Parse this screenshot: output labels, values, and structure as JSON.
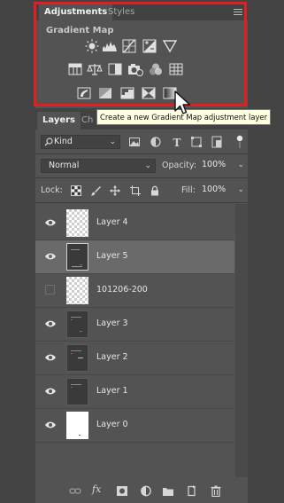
{
  "adjustments": {
    "tabs": [
      {
        "label": "Adjustments",
        "active": true
      },
      {
        "label": "Styles",
        "active": false
      }
    ],
    "subtitle": "Gradient Map",
    "highlight_color": "#e41e1e",
    "row1_icons": [
      "brightness-contrast-icon",
      "levels-icon",
      "curves-icon",
      "exposure-icon",
      "vibrance-icon"
    ],
    "row2_icons": [
      "hue-saturation-icon",
      "color-balance-icon",
      "black-white-icon",
      "photo-filter-icon",
      "channel-mixer-icon",
      "color-lookup-icon"
    ],
    "row3_icons": [
      "invert-icon",
      "posterize-icon",
      "threshold-icon",
      "selective-color-icon",
      "gradient-map-icon"
    ]
  },
  "tooltip": {
    "text": "Create a new Gradient Map adjustment layer"
  },
  "layers_panel": {
    "tabs": [
      {
        "label": "Layers",
        "active": true
      },
      {
        "label": "Ch",
        "active": false
      }
    ],
    "filter_kind": "Kind",
    "blend_mode": "Normal",
    "opacity_label": "Opacity:",
    "opacity_value": "100%",
    "lock_label": "Lock:",
    "fill_label": "Fill:",
    "fill_value": "100%",
    "layers": [
      {
        "name": "Layer 4",
        "visible": true,
        "selected": false,
        "thumb": "checker"
      },
      {
        "name": "Layer 5",
        "visible": true,
        "selected": true,
        "thumb": "dark"
      },
      {
        "name": "101206-200",
        "visible": false,
        "selected": false,
        "thumb": "checker"
      },
      {
        "name": "Layer 3",
        "visible": true,
        "selected": false,
        "thumb": "dark"
      },
      {
        "name": "Layer 2",
        "visible": true,
        "selected": false,
        "thumb": "dark"
      },
      {
        "name": "Layer 1",
        "visible": true,
        "selected": false,
        "thumb": "dark"
      },
      {
        "name": "Layer 0",
        "visible": true,
        "selected": false,
        "thumb": "white"
      }
    ],
    "bottom_fx": "fx"
  }
}
